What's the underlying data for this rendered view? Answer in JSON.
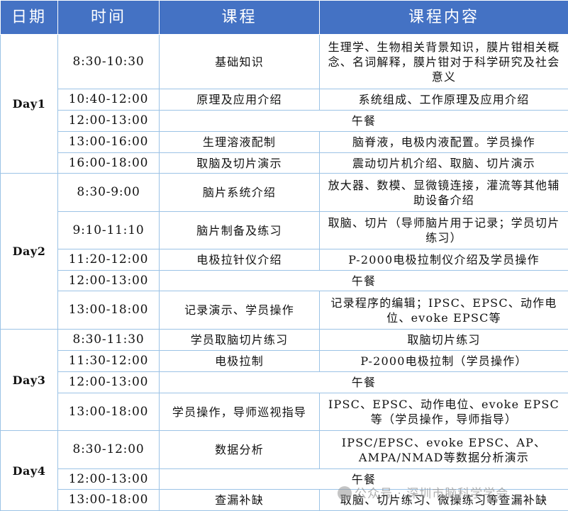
{
  "header": {
    "date": "日期",
    "time": "时间",
    "course": "课程",
    "content": "课程内容"
  },
  "days": [
    {
      "label": "Day1",
      "rows": [
        {
          "time": "8:30-10:30",
          "course": "基础知识",
          "content": "生理学、生物相关背景知识，膜片钳相关概念、名词解释，膜片钳对于科学研究及社会意义"
        },
        {
          "time": "10:40-12:00",
          "course": "原理及应用介绍",
          "content": "系统组成、工作原理及应用介绍"
        },
        {
          "time": "12:00-13:00",
          "course": "",
          "content": "午餐"
        },
        {
          "time": "13:00-16:00",
          "course": "生理溶液配制",
          "content": "脑脊液，电极内液配置。学员操作"
        },
        {
          "time": "16:00-18:00",
          "course": "取脑及切片演示",
          "content": "震动切片机介绍、取脑、切片演示"
        }
      ]
    },
    {
      "label": "Day2",
      "rows": [
        {
          "time": "8:30-9:00",
          "course": "脑片系统介绍",
          "content": "放大器、数模、显微镜连接，灌流等其他辅助设备介绍"
        },
        {
          "time": "9:10-11:10",
          "course": "脑片制备及练习",
          "content": "取脑、切片（导师脑片用于记录；学员切片练习）"
        },
        {
          "time": "11:20-12:00",
          "course": "电极拉针仪介绍",
          "content": "P-2000电极拉制仪介绍及学员操作"
        },
        {
          "time": "12:00-13:00",
          "course": "",
          "content": "午餐"
        },
        {
          "time": "13:00-18:00",
          "course": "记录演示、学员操作",
          "content": "记录程序的编辑；IPSC、EPSC、动作电位、evoke EPSC等"
        }
      ]
    },
    {
      "label": "Day3",
      "rows": [
        {
          "time": "8:30-11:30",
          "course": "学员取脑切片练习",
          "content": "取脑切片练习"
        },
        {
          "time": "11:30-12:00",
          "course": "电极拉制",
          "content": "P-2000电极拉制（学员操作）"
        },
        {
          "time": "12:00-13:00",
          "course": "",
          "content": "午餐"
        },
        {
          "time": "13:00-18:00",
          "course": "学员操作，导师巡视指导",
          "content": "IPSC、EPSC、动作电位、evoke EPSC等（学员操作，导师指导）"
        }
      ]
    },
    {
      "label": "Day4",
      "rows": [
        {
          "time": "8:30-12:00",
          "course": "数据分析",
          "content": "IPSC/EPSC、evoke EPSC、AP、AMPA/NMAD等数据分析演示"
        },
        {
          "time": "12:00-13:00",
          "course": "",
          "content": "午餐"
        },
        {
          "time": "13:00-18:00",
          "course": "查漏补缺",
          "content": "取脑、切片练习、微操练习等查漏补缺"
        }
      ]
    }
  ],
  "watermark": "公众号 · 深圳市脑科学学会"
}
